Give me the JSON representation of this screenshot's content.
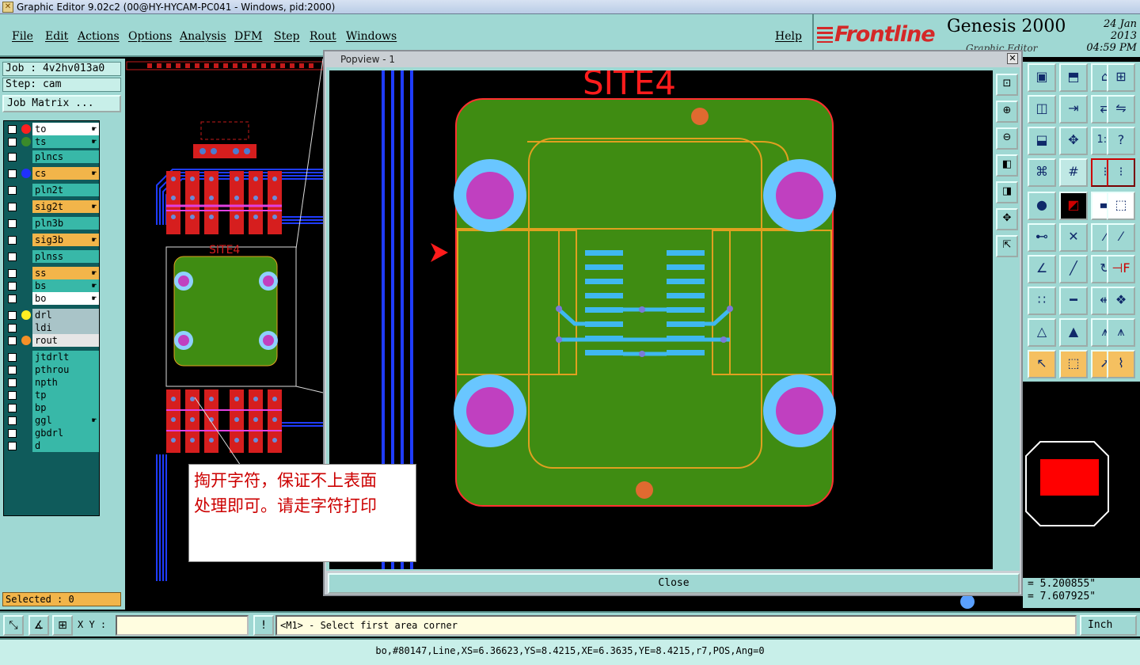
{
  "window": {
    "title": "Graphic Editor 9.02c2 (00@HY-HYCAM-PC041 - Windows, pid:2000)"
  },
  "menu": [
    "File",
    "Edit",
    "Actions",
    "Options",
    "Analysis",
    "DFM",
    "Step",
    "Rout",
    "Windows"
  ],
  "help": "Help",
  "brand": {
    "logo": "Frontline",
    "product": "Genesis 2000",
    "date": "24 Jan 2013",
    "time": "04:59 PM",
    "subtitle": "Graphic Editor"
  },
  "job": {
    "job": "Job : 4v2hv013a0",
    "step": "Step: cam",
    "matrix": "Job Matrix ..."
  },
  "layers": [
    {
      "name": "to",
      "color": "#ff2020",
      "bg": "#ffffff",
      "hand": true
    },
    {
      "name": "ts",
      "color": "#3a8a2a",
      "bg": "#38b8a8",
      "hand": true
    },
    {
      "name": "plncs",
      "color": "",
      "bg": "#38b8a8",
      "hand": false
    },
    {
      "name": "cs",
      "color": "#2030ff",
      "bg": "#f2b54a",
      "hand": true
    },
    {
      "name": "pln2t",
      "color": "",
      "bg": "#38b8a8",
      "hand": false
    },
    {
      "name": "sig2t",
      "color": "",
      "bg": "#f2b54a",
      "hand": true
    },
    {
      "name": "pln3b",
      "color": "",
      "bg": "#38b8a8",
      "hand": false
    },
    {
      "name": "sig3b",
      "color": "",
      "bg": "#f2b54a",
      "hand": true
    },
    {
      "name": "plnss",
      "color": "",
      "bg": "#38b8a8",
      "hand": false
    },
    {
      "name": "ss",
      "color": "",
      "bg": "#f2b54a",
      "hand": true
    },
    {
      "name": "bs",
      "color": "",
      "bg": "#38b8a8",
      "hand": true
    },
    {
      "name": "bo",
      "color": "",
      "bg": "#ffffff",
      "hand": true
    },
    {
      "name": "drl",
      "color": "#ffee22",
      "bg": "#a9c4c8",
      "hand": false
    },
    {
      "name": "ldi",
      "color": "",
      "bg": "#a9c4c8",
      "hand": false
    },
    {
      "name": "rout",
      "color": "#f59028",
      "bg": "#e6e6e6",
      "hand": false
    },
    {
      "name": "jtdrlt",
      "color": "",
      "bg": "#38b8a8",
      "hand": false
    },
    {
      "name": "pthrou",
      "color": "",
      "bg": "#38b8a8",
      "hand": false
    },
    {
      "name": "npth",
      "color": "",
      "bg": "#38b8a8",
      "hand": false
    },
    {
      "name": "tp",
      "color": "",
      "bg": "#38b8a8",
      "hand": false
    },
    {
      "name": "bp",
      "color": "",
      "bg": "#38b8a8",
      "hand": false
    },
    {
      "name": "ggl",
      "color": "",
      "bg": "#38b8a8",
      "hand": true
    },
    {
      "name": "gbdrl",
      "color": "",
      "bg": "#38b8a8",
      "hand": false
    },
    {
      "name": "d",
      "color": "",
      "bg": "#38b8a8",
      "hand": false
    }
  ],
  "selected": "Selected : 0",
  "popview": {
    "title": "Popview - 1",
    "close": "Close",
    "site_label": "SITE4"
  },
  "canvas": {
    "site_label": "SITE4"
  },
  "note": {
    "line1": "掏开字符，保证不上表面",
    "line2": "处理即可。请走字符打印"
  },
  "coords": {
    "x": "= 5.200855\"",
    "y": "= 7.607925\""
  },
  "cmd": {
    "xy_label": "X Y :",
    "xy_value": "",
    "prompt": "<M1> - Select first area corner",
    "units": "Inch"
  },
  "status": "bo,#80147,Line,XS=6.36623,YS=8.4215,XE=6.3635,YE=8.4215,r7,POS,Ang=0"
}
